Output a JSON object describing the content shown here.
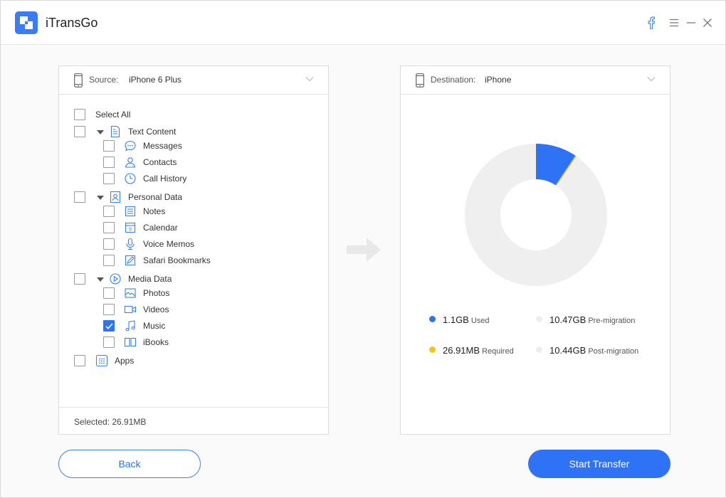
{
  "app": {
    "title": "iTransGo"
  },
  "source": {
    "label": "Source:",
    "device": "iPhone 6 Plus",
    "select_all": "Select All",
    "groups": [
      {
        "label": "Text Content",
        "items": [
          {
            "label": "Messages",
            "checked": false
          },
          {
            "label": "Contacts",
            "checked": false
          },
          {
            "label": "Call History",
            "checked": false
          }
        ]
      },
      {
        "label": "Personal Data",
        "items": [
          {
            "label": "Notes",
            "checked": false
          },
          {
            "label": "Calendar",
            "checked": false
          },
          {
            "label": "Voice Memos",
            "checked": false
          },
          {
            "label": "Safari Bookmarks",
            "checked": false
          }
        ]
      },
      {
        "label": "Media Data",
        "items": [
          {
            "label": "Photos",
            "checked": false
          },
          {
            "label": "Videos",
            "checked": false
          },
          {
            "label": "Music",
            "checked": true
          },
          {
            "label": "iBooks",
            "checked": false
          }
        ]
      }
    ],
    "apps_label": "Apps",
    "selected_text": "Selected: 26.91MB"
  },
  "destination": {
    "label": "Destination:",
    "device": "iPhone",
    "legend": {
      "used": {
        "value": "1.1GB",
        "caption": "Used",
        "color": "#2e73f5"
      },
      "pre": {
        "value": "10.47GB",
        "caption": "Pre-migration",
        "color": "#eeeeee"
      },
      "required": {
        "value": "26.91MB",
        "caption": "Required",
        "color": "#f5c518"
      },
      "post": {
        "value": "10.44GB",
        "caption": "Post-migration",
        "color": "#eeeeee"
      }
    }
  },
  "buttons": {
    "back": "Back",
    "start": "Start Transfer"
  },
  "colors": {
    "accent": "#2e73f5",
    "required": "#f5c518",
    "free": "#efefef"
  }
}
